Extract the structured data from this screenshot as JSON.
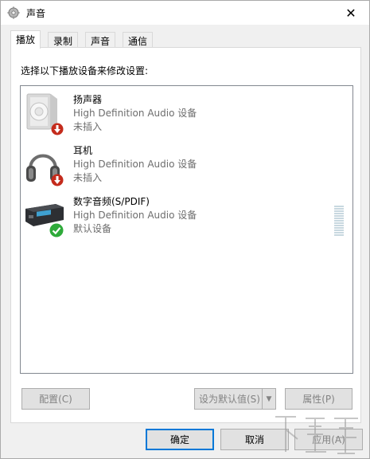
{
  "window": {
    "title": "声音",
    "close_glyph": "✕"
  },
  "tabs": [
    {
      "label": "播放",
      "active": true
    },
    {
      "label": "录制",
      "active": false
    },
    {
      "label": "声音",
      "active": false
    },
    {
      "label": "通信",
      "active": false
    }
  ],
  "panel": {
    "instruction": "选择以下播放设备来修改设置:"
  },
  "devices": [
    {
      "name": "扬声器",
      "driver": "High Definition Audio 设备",
      "status": "未插入",
      "icon": "speaker-icon",
      "badge": "unplugged-badge-icon"
    },
    {
      "name": "耳机",
      "driver": "High Definition Audio 设备",
      "status": "未插入",
      "icon": "headphones-icon",
      "badge": "unplugged-badge-icon"
    },
    {
      "name": "数字音频(S/PDIF)",
      "driver": "High Definition Audio 设备",
      "status": "默认设备",
      "icon": "digital-audio-icon",
      "badge": "default-check-icon"
    }
  ],
  "buttons": {
    "configure": "配置(C)",
    "set_default": "设为默认值(S)",
    "properties": "属性(P)",
    "ok": "确定",
    "cancel": "取消",
    "apply": "应用(A)"
  },
  "colors": {
    "accent": "#0078d7",
    "disabled_text": "#838383",
    "secondary_text": "#6d6d6d",
    "check_green": "#2eaa3a",
    "unplug_red": "#c42b1c"
  }
}
